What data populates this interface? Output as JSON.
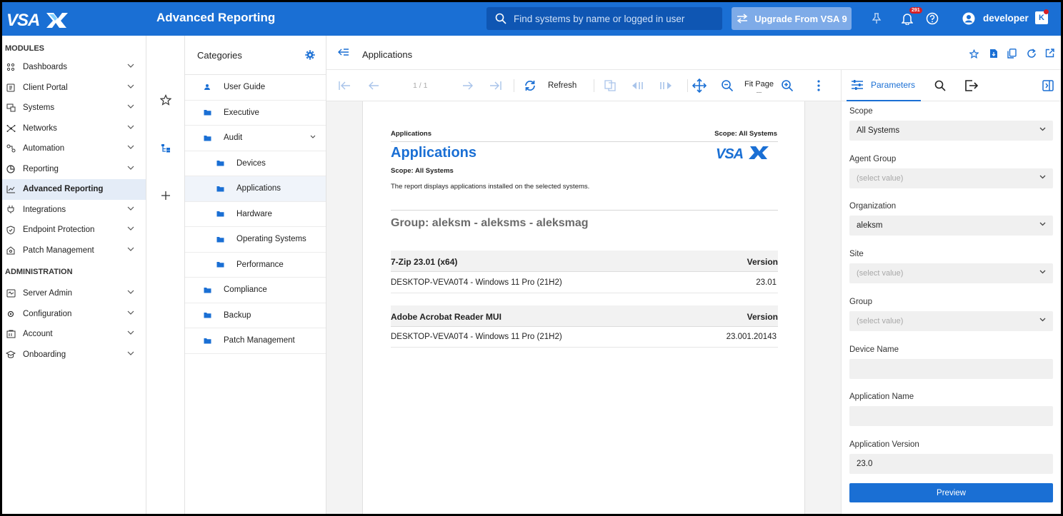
{
  "app": {
    "logo_text": "VSAX",
    "title": "Advanced Reporting"
  },
  "topbar": {
    "search_placeholder": "Find systems by name or logged in user",
    "upgrade_label": "Upgrade From VSA 9",
    "notification_count": "291",
    "user_name": "developer",
    "user_tag": "K"
  },
  "nav": {
    "modules_heading": "MODULES",
    "modules": [
      {
        "label": "Dashboards",
        "icon": "dashboard-icon"
      },
      {
        "label": "Client Portal",
        "icon": "portal-icon"
      },
      {
        "label": "Systems",
        "icon": "systems-icon"
      },
      {
        "label": "Networks",
        "icon": "networks-icon"
      },
      {
        "label": "Automation",
        "icon": "automation-icon"
      },
      {
        "label": "Reporting",
        "icon": "reporting-icon"
      },
      {
        "label": "Advanced Reporting",
        "icon": "chart-line-icon",
        "active": true
      },
      {
        "label": "Integrations",
        "icon": "plug-icon"
      },
      {
        "label": "Endpoint Protection",
        "icon": "shield-icon"
      },
      {
        "label": "Patch Management",
        "icon": "patch-icon"
      }
    ],
    "admin_heading": "ADMINISTRATION",
    "admin": [
      {
        "label": "Server Admin",
        "icon": "server-icon"
      },
      {
        "label": "Configuration",
        "icon": "gear-icon"
      },
      {
        "label": "Account",
        "icon": "account-icon"
      },
      {
        "label": "Onboarding",
        "icon": "graduation-icon"
      }
    ]
  },
  "categories": {
    "heading": "Categories",
    "items": [
      {
        "label": "User Guide",
        "level": 1,
        "icon": "user-icon"
      },
      {
        "label": "Executive",
        "level": 1,
        "icon": "folder-icon"
      },
      {
        "label": "Audit",
        "level": 1,
        "icon": "folder-icon",
        "expanded": true
      },
      {
        "label": "Devices",
        "level": 2,
        "icon": "folder-icon"
      },
      {
        "label": "Applications",
        "level": 2,
        "icon": "folder-icon",
        "selected": true
      },
      {
        "label": "Hardware",
        "level": 2,
        "icon": "folder-icon"
      },
      {
        "label": "Operating Systems",
        "level": 2,
        "icon": "folder-icon"
      },
      {
        "label": "Performance",
        "level": 2,
        "icon": "folder-icon"
      },
      {
        "label": "Compliance",
        "level": 1,
        "icon": "folder-icon"
      },
      {
        "label": "Backup",
        "level": 1,
        "icon": "folder-icon"
      },
      {
        "label": "Patch Management",
        "level": 1,
        "icon": "folder-icon"
      }
    ]
  },
  "report": {
    "header_title": "Applications",
    "page_indicator": "1 / 1",
    "refresh_label": "Refresh",
    "fit_page_label": "Fit Page",
    "fit_page_ellipsis": "...",
    "doc": {
      "header_left": "Applications",
      "header_right": "Scope: All Systems",
      "title": "Applications",
      "logo_text": "VSAX",
      "scope": "Scope: All Systems",
      "description": "The report displays applications installed on the selected systems.",
      "group": "Group: aleksm - aleksms - aleksmag",
      "tables": [
        {
          "name": "7-Zip 23.01 (x64)",
          "version_header": "Version",
          "rows": [
            {
              "system": "DESKTOP-VEVA0T4 - Windows 11 Pro (21H2)",
              "version": "23.01"
            }
          ]
        },
        {
          "name": "Adobe Acrobat Reader MUI",
          "version_header": "Version",
          "rows": [
            {
              "system": "DESKTOP-VEVA0T4 - Windows 11 Pro (21H2)",
              "version": "23.001.20143"
            }
          ]
        }
      ]
    }
  },
  "params": {
    "tab_label": "Parameters",
    "fields": [
      {
        "label": "Scope",
        "value": "All Systems",
        "placeholder": false,
        "dropdown": true
      },
      {
        "label": "Agent Group",
        "value": "(select value)",
        "placeholder": true,
        "dropdown": true
      },
      {
        "label": "Organization",
        "value": "aleksm",
        "placeholder": false,
        "dropdown": true
      },
      {
        "label": "Site",
        "value": "(select value)",
        "placeholder": true,
        "dropdown": true
      },
      {
        "label": "Group",
        "value": "(select value)",
        "placeholder": true,
        "dropdown": true
      },
      {
        "label": "Device Name",
        "value": "",
        "placeholder": false,
        "dropdown": false
      },
      {
        "label": "Application Name",
        "value": "",
        "placeholder": false,
        "dropdown": false
      },
      {
        "label": "Application Version",
        "value": "23.0",
        "placeholder": false,
        "dropdown": false
      }
    ],
    "preview_label": "Preview"
  },
  "colors": {
    "brand": "#1a6fd4",
    "topbar_search": "#0f56b3",
    "upgrade_button": "#7eabe8",
    "badge": "#d81f26"
  }
}
